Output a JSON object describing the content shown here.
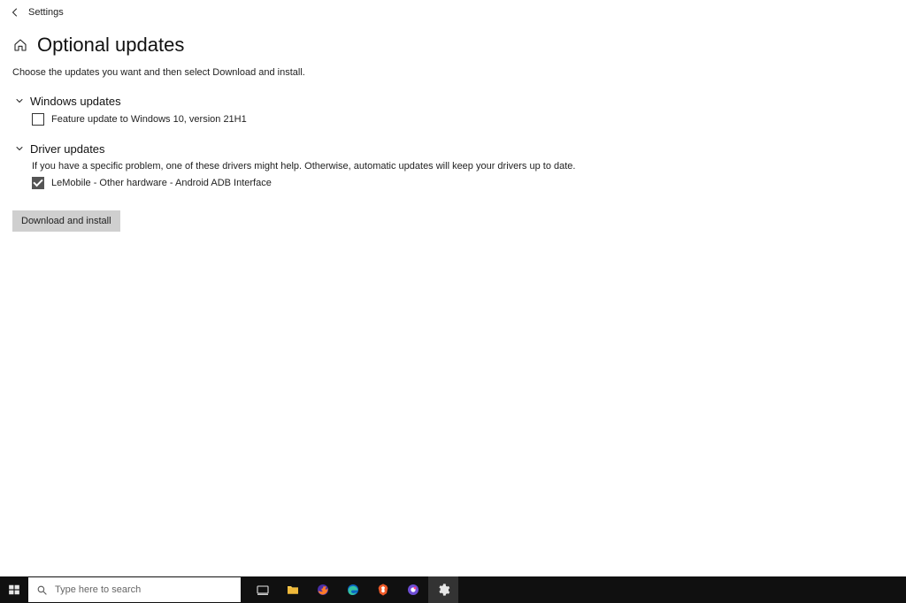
{
  "breadcrumb": "Settings",
  "page_title": "Optional updates",
  "description": "Choose the updates you want and then select Download and install.",
  "sections": {
    "windows": {
      "title": "Windows updates",
      "items": [
        {
          "label": "Feature update to Windows 10, version 21H1",
          "checked": false
        }
      ]
    },
    "drivers": {
      "title": "Driver updates",
      "subtext": "If you have a specific problem, one of these drivers might help. Otherwise, automatic updates will keep your drivers up to date.",
      "items": [
        {
          "label": "LeMobile - Other hardware - Android ADB Interface",
          "checked": true
        }
      ]
    }
  },
  "action_button": "Download and install",
  "taskbar": {
    "search_placeholder": "Type here to search"
  }
}
